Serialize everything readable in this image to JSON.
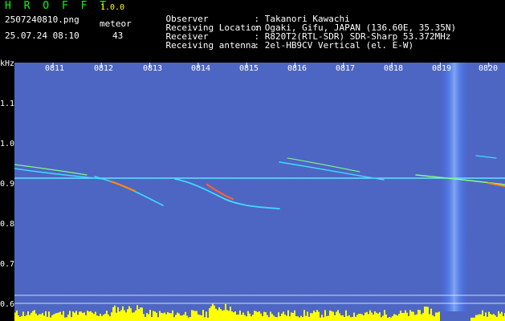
{
  "app": {
    "title": "H R O F F T",
    "version": "1.0.0",
    "filename": "2507240810.png",
    "type_label": "meteor",
    "datetime": "25.07.24 08:10",
    "count": "43"
  },
  "info": [
    {
      "key": "Observer",
      "value": ": Takanori Kawachi"
    },
    {
      "key": "Receiving Location",
      "value": ": Ogaki, Gifu, JAPAN (136.60E, 35.35N)"
    },
    {
      "key": "Receiver",
      "value": ": R820T2(RTL-SDR) SDR-Sharp 53.372MHz"
    },
    {
      "key": "Receiving antenna",
      "value": ": 2el-HB9CV Vertical (el. E-W)"
    }
  ],
  "axis": {
    "y_unit": "kHz",
    "y_ticks": [
      "1.1",
      "1.0",
      "0.9",
      "0.8",
      "0.7",
      "0.6"
    ],
    "x_ticks": [
      "0811",
      "0812",
      "0813",
      "0814",
      "0815",
      "0816",
      "0817",
      "0818",
      "0819",
      "0820"
    ]
  },
  "colors": {
    "background": "#000000",
    "spectrum_bg": "#0a0f6a",
    "carrier": "#3fd9ff",
    "trace": "#ff8c00",
    "level_bar": "#ffff00"
  }
}
